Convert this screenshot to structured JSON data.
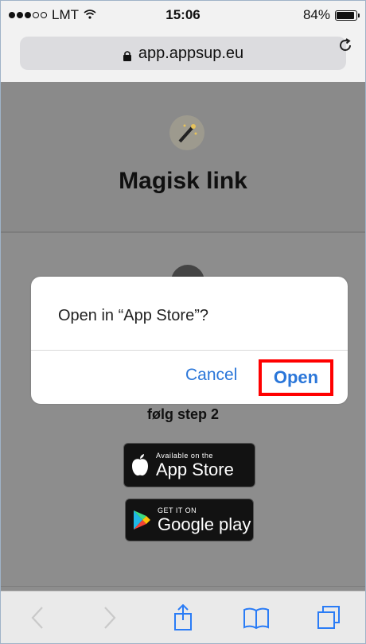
{
  "status_bar": {
    "carrier": "LMT",
    "time": "15:06",
    "battery": "84%"
  },
  "browser": {
    "url": "app.appsup.eu"
  },
  "page": {
    "title": "Magisk link",
    "step_text": "følg step 2",
    "apple_badge": {
      "small": "Available on the",
      "big": "App Store"
    },
    "google_badge": {
      "small": "GET IT ON",
      "big": "Google play"
    }
  },
  "dialog": {
    "message": "Open in “App Store”?",
    "cancel_label": "Cancel",
    "open_label": "Open",
    "highlight_color": "#ff0000"
  },
  "toolbar": {
    "icons": [
      "back-icon",
      "forward-icon",
      "share-icon",
      "bookmarks-icon",
      "tabs-icon"
    ]
  }
}
